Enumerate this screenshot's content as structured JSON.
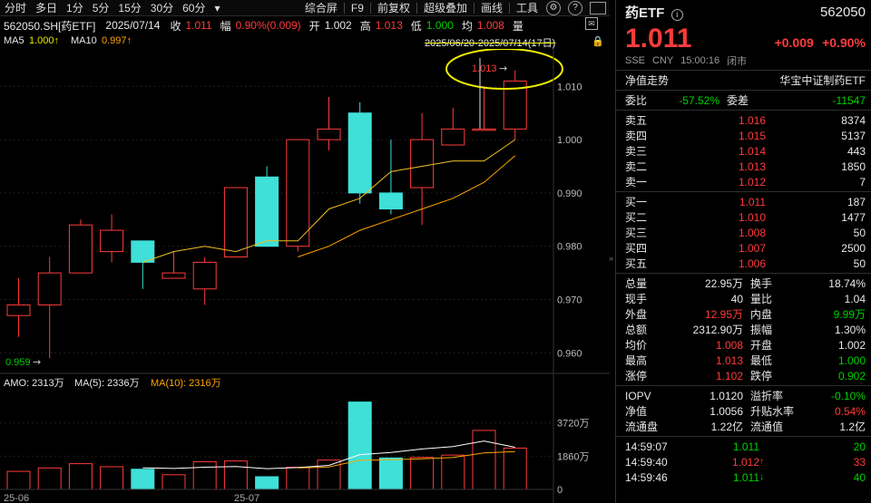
{
  "toolbar": {
    "periods": [
      "分时",
      "多日",
      "1分",
      "5分",
      "15分",
      "30分",
      "60分"
    ],
    "tools": [
      "综合屏",
      "F9",
      "前复权",
      "超级叠加",
      "画线",
      "工具"
    ],
    "icons": [
      "settings-icon",
      "help-icon"
    ]
  },
  "info": {
    "code": "562050.SH[药ETF]",
    "date": "2025/07/14",
    "close_label": "收",
    "close": "1.011",
    "chg_label": "幅",
    "chg": "0.90%(0.009)",
    "open_label": "开",
    "open": "1.002",
    "high_label": "高",
    "high": "1.013",
    "low_label": "低",
    "low": "1.000",
    "avg_label": "均",
    "avg": "1.008",
    "vol_label": "量",
    "range_text": "2025/06/20-2025/07/14(17日)"
  },
  "ma": {
    "ma5_label": "MA5",
    "ma5": "1.000↑",
    "ma10_label": "MA10",
    "ma10": "0.997↑"
  },
  "amo": {
    "label": "AMO: 2313万",
    "ma5": "MA(5): 2336万",
    "ma10": "MA(10): 2316万"
  },
  "annotations": {
    "high_mark": "1.013",
    "low_mark": "0.959"
  },
  "axis": {
    "price_ticks": [
      "1.010",
      "1.000",
      "0.990",
      "0.980",
      "0.970",
      "0.960"
    ],
    "vol_ticks": [
      "3720万",
      "1860万",
      "0"
    ],
    "dates": [
      "25-06",
      "25-07"
    ]
  },
  "chart_data": {
    "type": "candlestick",
    "ylim": [
      0.957,
      1.016
    ],
    "candles": [
      {
        "o": 0.967,
        "c": 0.969,
        "h": 0.974,
        "l": 0.963
      },
      {
        "o": 0.969,
        "c": 0.975,
        "h": 0.978,
        "l": 0.959
      },
      {
        "o": 0.975,
        "c": 0.984,
        "h": 0.985,
        "l": 0.975
      },
      {
        "o": 0.979,
        "c": 0.983,
        "h": 0.986,
        "l": 0.977
      },
      {
        "o": 0.981,
        "c": 0.977,
        "h": 0.981,
        "l": 0.972
      },
      {
        "o": 0.974,
        "c": 0.975,
        "h": 0.979,
        "l": 0.974
      },
      {
        "o": 0.972,
        "c": 0.977,
        "h": 0.978,
        "l": 0.969
      },
      {
        "o": 0.978,
        "c": 0.991,
        "h": 0.991,
        "l": 0.978
      },
      {
        "o": 0.993,
        "c": 0.98,
        "h": 0.995,
        "l": 0.98
      },
      {
        "o": 0.98,
        "c": 1.0,
        "h": 1.0,
        "l": 0.979
      },
      {
        "o": 1.0,
        "c": 1.002,
        "h": 1.008,
        "l": 0.998
      },
      {
        "o": 1.005,
        "c": 0.99,
        "h": 1.007,
        "l": 0.988
      },
      {
        "o": 0.99,
        "c": 0.987,
        "h": 1.0,
        "l": 0.986
      },
      {
        "o": 0.991,
        "c": 1.0,
        "h": 1.005,
        "l": 0.984
      },
      {
        "o": 0.999,
        "c": 1.002,
        "h": 1.006,
        "l": 0.999
      },
      {
        "o": 1.002,
        "c": 1.002,
        "h": 1.01,
        "l": 1.002
      },
      {
        "o": 1.002,
        "c": 1.011,
        "h": 1.013,
        "l": 1.0
      }
    ],
    "ma5": [
      null,
      null,
      null,
      null,
      0.977,
      0.979,
      0.98,
      0.979,
      0.981,
      0.981,
      0.987,
      0.989,
      0.994,
      0.995,
      0.996,
      0.996,
      1.0
    ],
    "ma10": [
      null,
      null,
      null,
      null,
      null,
      null,
      null,
      null,
      null,
      0.978,
      0.98,
      0.983,
      0.985,
      0.987,
      0.989,
      0.992,
      0.997
    ],
    "volume": [
      1010,
      1200,
      1440,
      1270,
      1130,
      820,
      1550,
      1590,
      710,
      1240,
      1640,
      4890,
      1760,
      1790,
      1920,
      3300,
      2313
    ],
    "vol_ma5": [
      null,
      null,
      null,
      null,
      1210,
      1172,
      1242,
      1276,
      1160,
      1222,
      1346,
      1946,
      2068,
      2262,
      2400,
      2710,
      2360
    ],
    "vol_ma10": [
      null,
      null,
      null,
      null,
      null,
      null,
      null,
      null,
      null,
      1196,
      1260,
      1629,
      1660,
      1712,
      1793,
      2040,
      2116
    ],
    "vol_ylim": [
      0,
      5580
    ]
  },
  "quote": {
    "name": "药ETF",
    "code": "562050",
    "price": "1.011",
    "change": "+0.009",
    "pct": "+0.90%",
    "exchange": "SSE",
    "currency": "CNY",
    "time": "15:00:16",
    "status": "闭市",
    "tab_left": "净值走势",
    "tab_right": "华宝中证制药ETF",
    "weibi_label": "委比",
    "weibi": "-57.52%",
    "weicha_label": "委差",
    "weicha": "-11547"
  },
  "asks": [
    {
      "label": "卖五",
      "price": "1.016",
      "vol": "8374"
    },
    {
      "label": "卖四",
      "price": "1.015",
      "vol": "5137"
    },
    {
      "label": "卖三",
      "price": "1.014",
      "vol": "443"
    },
    {
      "label": "卖二",
      "price": "1.013",
      "vol": "1850"
    },
    {
      "label": "卖一",
      "price": "1.012",
      "vol": "7"
    }
  ],
  "bids": [
    {
      "label": "买一",
      "price": "1.011",
      "vol": "187"
    },
    {
      "label": "买二",
      "price": "1.010",
      "vol": "1477"
    },
    {
      "label": "买三",
      "price": "1.008",
      "vol": "50"
    },
    {
      "label": "买四",
      "price": "1.007",
      "vol": "2500"
    },
    {
      "label": "买五",
      "price": "1.006",
      "vol": "50"
    }
  ],
  "stats": [
    {
      "l1": "总量",
      "v1": "22.95万",
      "c1": "white",
      "l2": "换手",
      "v2": "18.74%",
      "c2": "white"
    },
    {
      "l1": "现手",
      "v1": "40",
      "c1": "white",
      "l2": "量比",
      "v2": "1.04",
      "c2": "white"
    },
    {
      "l1": "外盘",
      "v1": "12.95万",
      "c1": "red",
      "l2": "内盘",
      "v2": "9.99万",
      "c2": "green"
    },
    {
      "l1": "总额",
      "v1": "2312.90万",
      "c1": "white",
      "l2": "振幅",
      "v2": "1.30%",
      "c2": "white"
    },
    {
      "l1": "均价",
      "v1": "1.008",
      "c1": "red",
      "l2": "开盘",
      "v2": "1.002",
      "c2": "white"
    },
    {
      "l1": "最高",
      "v1": "1.013",
      "c1": "red",
      "l2": "最低",
      "v2": "1.000",
      "c2": "green"
    },
    {
      "l1": "涨停",
      "v1": "1.102",
      "c1": "red",
      "l2": "跌停",
      "v2": "0.902",
      "c2": "green"
    }
  ],
  "stats2": [
    {
      "l1": "IOPV",
      "v1": "1.0120",
      "c1": "white",
      "l2": "溢折率",
      "v2": "-0.10%",
      "c2": "green"
    },
    {
      "l1": "净值",
      "v1": "1.0056",
      "c1": "white",
      "l2": "升贴水率",
      "v2": "0.54%",
      "c2": "red"
    },
    {
      "l1": "流通盘",
      "v1": "1.22亿",
      "c1": "white",
      "l2": "流通值",
      "v2": "1.2亿",
      "c2": "white"
    }
  ],
  "ticks": [
    {
      "time": "14:59:07",
      "price": "1.011",
      "arrow": "",
      "vol": "20",
      "c": "green"
    },
    {
      "time": "14:59:40",
      "price": "1.012",
      "arrow": "↑",
      "vol": "33",
      "c": "red"
    },
    {
      "time": "14:59:46",
      "price": "1.011",
      "arrow": "↓",
      "vol": "40",
      "c": "green"
    }
  ],
  "colors": {
    "up": "#ff3b3b",
    "down": "#3ee0d8",
    "ma5": "#ffffff",
    "ma10": "#ffa500",
    "ma5_price": "#f0c020",
    "highlight": "#f0f000"
  }
}
